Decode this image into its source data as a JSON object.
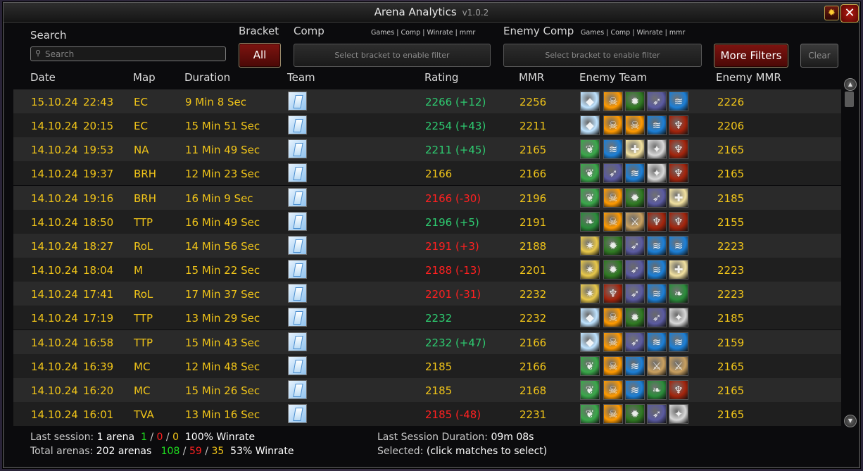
{
  "app": {
    "title": "Arena Analytics",
    "version": "v1.0.2"
  },
  "filters": {
    "search_label": "Search",
    "search_placeholder": "Search",
    "bracket_label": "Bracket",
    "bracket_value": "All",
    "comp_label": "Comp",
    "comp_sub": "Games | Comp | Winrate | mmr",
    "comp_placeholder": "Select bracket to enable filter",
    "enemy_comp_label": "Enemy Comp",
    "enemy_comp_sub": "Games | Comp | Winrate | mmr",
    "enemy_comp_placeholder": "Select bracket to enable filter",
    "more_filters": "More Filters",
    "clear": "Clear"
  },
  "columns": {
    "date": "Date",
    "map": "Map",
    "duration": "Duration",
    "team": "Team",
    "rating": "Rating",
    "mmr": "MMR",
    "enemy_team": "Enemy Team",
    "enemy_mmr": "Enemy MMR"
  },
  "icon_colors": {
    "mage": "#bfe3ff",
    "warlock": "#ff9a00",
    "dk": "#2f7a22",
    "hunter": "#5a5aa0",
    "shaman": "#1c7fd6",
    "dh": "#a3240c",
    "druid": "#3aa84a",
    "paladin": "#f2e1a0",
    "warrior": "#c9a060",
    "rogue": "#d8d8d8",
    "priest": "#e8c84a",
    "evoker": "#2a8c3a"
  },
  "rows": [
    {
      "date": "15.10.24",
      "time": "22:43",
      "map": "EC",
      "duration": "9 Min 8 Sec",
      "rating": "2266 (+12)",
      "rating_color": "#2ecc71",
      "mmr": "2256",
      "enemy": [
        "mage",
        "warlock",
        "dk",
        "hunter",
        "shaman"
      ],
      "enemy_mmr": "2226"
    },
    {
      "date": "14.10.24",
      "time": "20:15",
      "map": "EC",
      "duration": "15 Min 51 Sec",
      "rating": "2254 (+43)",
      "rating_color": "#2ecc71",
      "mmr": "2211",
      "enemy": [
        "mage",
        "warlock",
        "warlock",
        "shaman",
        "dh"
      ],
      "enemy_mmr": "2206"
    },
    {
      "date": "14.10.24",
      "time": "19:53",
      "map": "NA",
      "duration": "11 Min 49 Sec",
      "rating": "2211 (+45)",
      "rating_color": "#2ecc71",
      "mmr": "2165",
      "enemy": [
        "druid",
        "shaman",
        "paladin",
        "rogue",
        "dh"
      ],
      "enemy_mmr": "2165"
    },
    {
      "date": "14.10.24",
      "time": "19:37",
      "map": "BRH",
      "duration": "12 Min 23 Sec",
      "rating": "2166",
      "rating_color": "#f0c419",
      "mmr": "2166",
      "enemy": [
        "druid",
        "hunter",
        "shaman",
        "rogue",
        "dh"
      ],
      "enemy_mmr": "2165"
    },
    {
      "date": "14.10.24",
      "time": "19:16",
      "map": "BRH",
      "duration": "16 Min 9 Sec",
      "rating": "2166 (-30)",
      "rating_color": "#ff2020",
      "mmr": "2196",
      "enemy": [
        "druid",
        "warlock",
        "dk",
        "hunter",
        "paladin"
      ],
      "enemy_mmr": "2185"
    },
    {
      "date": "14.10.24",
      "time": "18:50",
      "map": "TTP",
      "duration": "16 Min 49 Sec",
      "rating": "2196 (+5)",
      "rating_color": "#2ecc71",
      "mmr": "2191",
      "enemy": [
        "evoker",
        "warlock",
        "warrior",
        "dh",
        "dh"
      ],
      "enemy_mmr": "2155"
    },
    {
      "date": "14.10.24",
      "time": "18:27",
      "map": "RoL",
      "duration": "14 Min 56 Sec",
      "rating": "2191 (+3)",
      "rating_color": "#ff2020",
      "mmr": "2188",
      "enemy": [
        "priest",
        "dk",
        "hunter",
        "shaman",
        "shaman"
      ],
      "enemy_mmr": "2223"
    },
    {
      "date": "14.10.24",
      "time": "18:04",
      "map": "M",
      "duration": "15 Min 22 Sec",
      "rating": "2188 (-13)",
      "rating_color": "#ff2020",
      "mmr": "2201",
      "enemy": [
        "priest",
        "dk",
        "hunter",
        "shaman",
        "paladin"
      ],
      "enemy_mmr": "2223"
    },
    {
      "date": "14.10.24",
      "time": "17:41",
      "map": "RoL",
      "duration": "17 Min 37 Sec",
      "rating": "2201 (-31)",
      "rating_color": "#ff2020",
      "mmr": "2232",
      "enemy": [
        "priest",
        "dh",
        "hunter",
        "shaman",
        "evoker"
      ],
      "enemy_mmr": "2223"
    },
    {
      "date": "14.10.24",
      "time": "17:19",
      "map": "TTP",
      "duration": "13 Min 29 Sec",
      "rating": "2232",
      "rating_color": "#2ecc71",
      "mmr": "2232",
      "enemy": [
        "mage",
        "warlock",
        "dk",
        "hunter",
        "rogue"
      ],
      "enemy_mmr": "2185"
    },
    {
      "date": "14.10.24",
      "time": "16:58",
      "map": "TTP",
      "duration": "15 Min 43 Sec",
      "rating": "2232 (+47)",
      "rating_color": "#2ecc71",
      "mmr": "2166",
      "enemy": [
        "mage",
        "warlock",
        "hunter",
        "shaman",
        "shaman"
      ],
      "enemy_mmr": "2159"
    },
    {
      "date": "14.10.24",
      "time": "16:39",
      "map": "MC",
      "duration": "12 Min 48 Sec",
      "rating": "2185",
      "rating_color": "#f0c419",
      "mmr": "2166",
      "enemy": [
        "druid",
        "warlock",
        "shaman",
        "warrior",
        "warrior"
      ],
      "enemy_mmr": "2165"
    },
    {
      "date": "14.10.24",
      "time": "16:20",
      "map": "MC",
      "duration": "15 Min 26 Sec",
      "rating": "2185",
      "rating_color": "#f0c419",
      "mmr": "2168",
      "enemy": [
        "druid",
        "warlock",
        "shaman",
        "evoker",
        "dh"
      ],
      "enemy_mmr": "2165"
    },
    {
      "date": "14.10.24",
      "time": "16:01",
      "map": "TVA",
      "duration": "13 Min 16 Sec",
      "rating": "2185 (-48)",
      "rating_color": "#ff2020",
      "mmr": "2231",
      "enemy": [
        "druid",
        "warlock",
        "dk",
        "hunter",
        "rogue"
      ],
      "enemy_mmr": "2165"
    }
  ],
  "footer": {
    "last_session_label": "Last session:",
    "last_session_count": "1 arena",
    "ls_w": "1",
    "ls_l": "0",
    "ls_d": "0",
    "ls_winrate": "100% Winrate",
    "total_label": "Total arenas:",
    "total_count": "202 arenas",
    "t_w": "108",
    "t_l": "59",
    "t_d": "35",
    "t_winrate": "53% Winrate",
    "duration_label": "Last Session Duration:",
    "duration_value": "09m 08s",
    "selected_label": "Selected:",
    "selected_value": "(click matches to select)"
  }
}
